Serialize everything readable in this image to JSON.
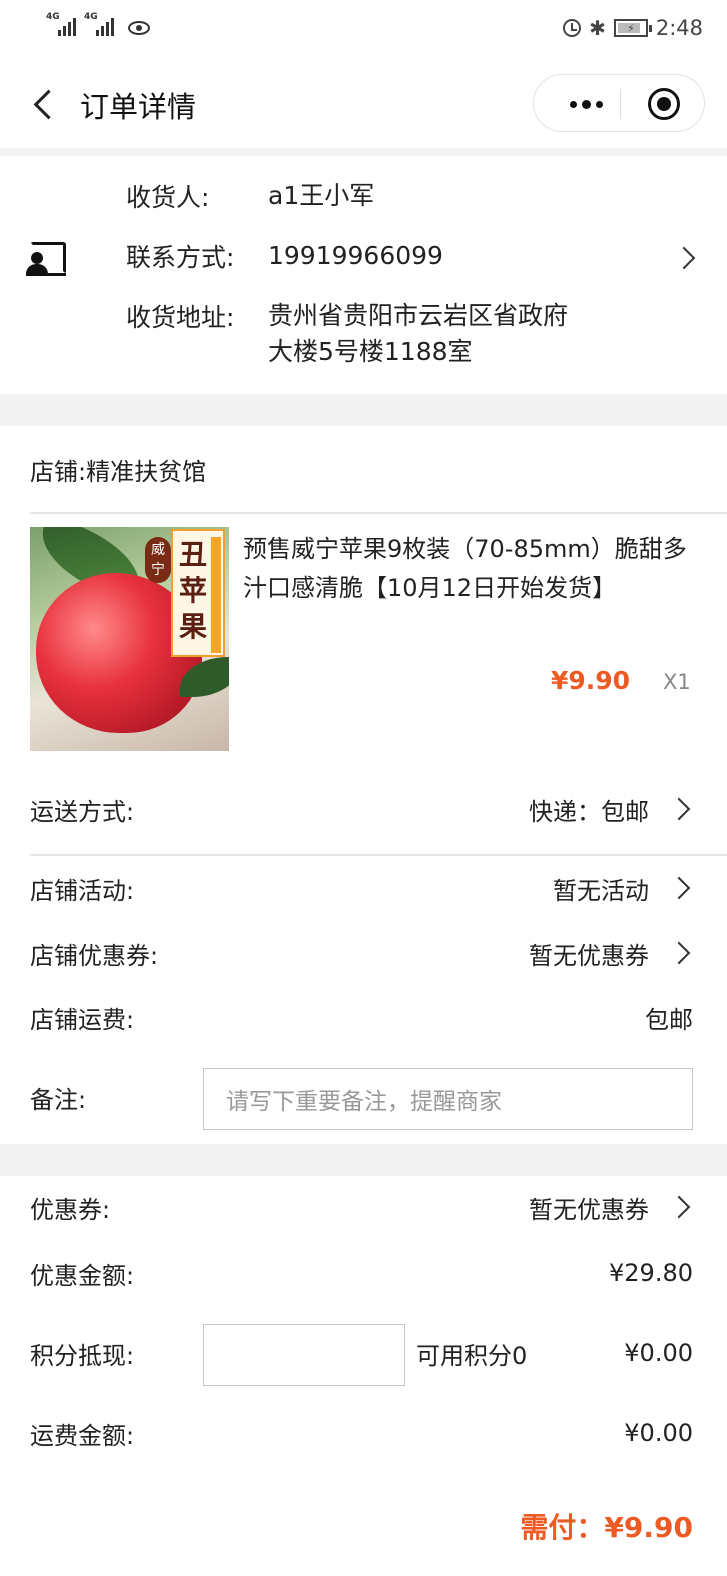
{
  "status_bar": {
    "network1": "4G",
    "network2": "4G",
    "time": "2:48"
  },
  "nav": {
    "title": "订单详情"
  },
  "address": {
    "receiver_label": "收货人:",
    "receiver_value": "a1王小军",
    "contact_label": "联系方式:",
    "contact_value": "19919966099",
    "addr_label": "收货地址:",
    "addr_value": "贵州省贵阳市云岩区省政府大楼5号楼1188室"
  },
  "store": {
    "name": "店铺:精准扶贫馆",
    "product": {
      "image_badge": "威宁",
      "image_title": "丑苹果",
      "title": "预售威宁苹果9枚装（70-85mm）脆甜多汁口感清脆【10月12日开始发货】",
      "price": "¥9.90",
      "qty": "X1"
    },
    "shipping_label": "运送方式:",
    "shipping_value": "快递：包邮",
    "activity_label": "店铺活动:",
    "activity_value": "暂无活动",
    "coupon_label": "店铺优惠券:",
    "coupon_value": "暂无优惠券",
    "freight_label": "店铺运费:",
    "freight_value": "包邮",
    "note_label": "备注:",
    "note_placeholder": "请写下重要备注，提醒商家"
  },
  "summary": {
    "coupon_label": "优惠券:",
    "coupon_value": "暂无优惠券",
    "discount_label": "优惠金额:",
    "discount_value": "¥29.80",
    "points_label": "积分抵现:",
    "points_available": "可用积分0",
    "points_value": "¥0.00",
    "freight_label": "运费金额:",
    "freight_value": "¥0.00",
    "pay_label": "需付：",
    "pay_value": "¥9.90"
  },
  "colors": {
    "accent": "#ee5a24",
    "background_gap": "#f3f3f3"
  }
}
